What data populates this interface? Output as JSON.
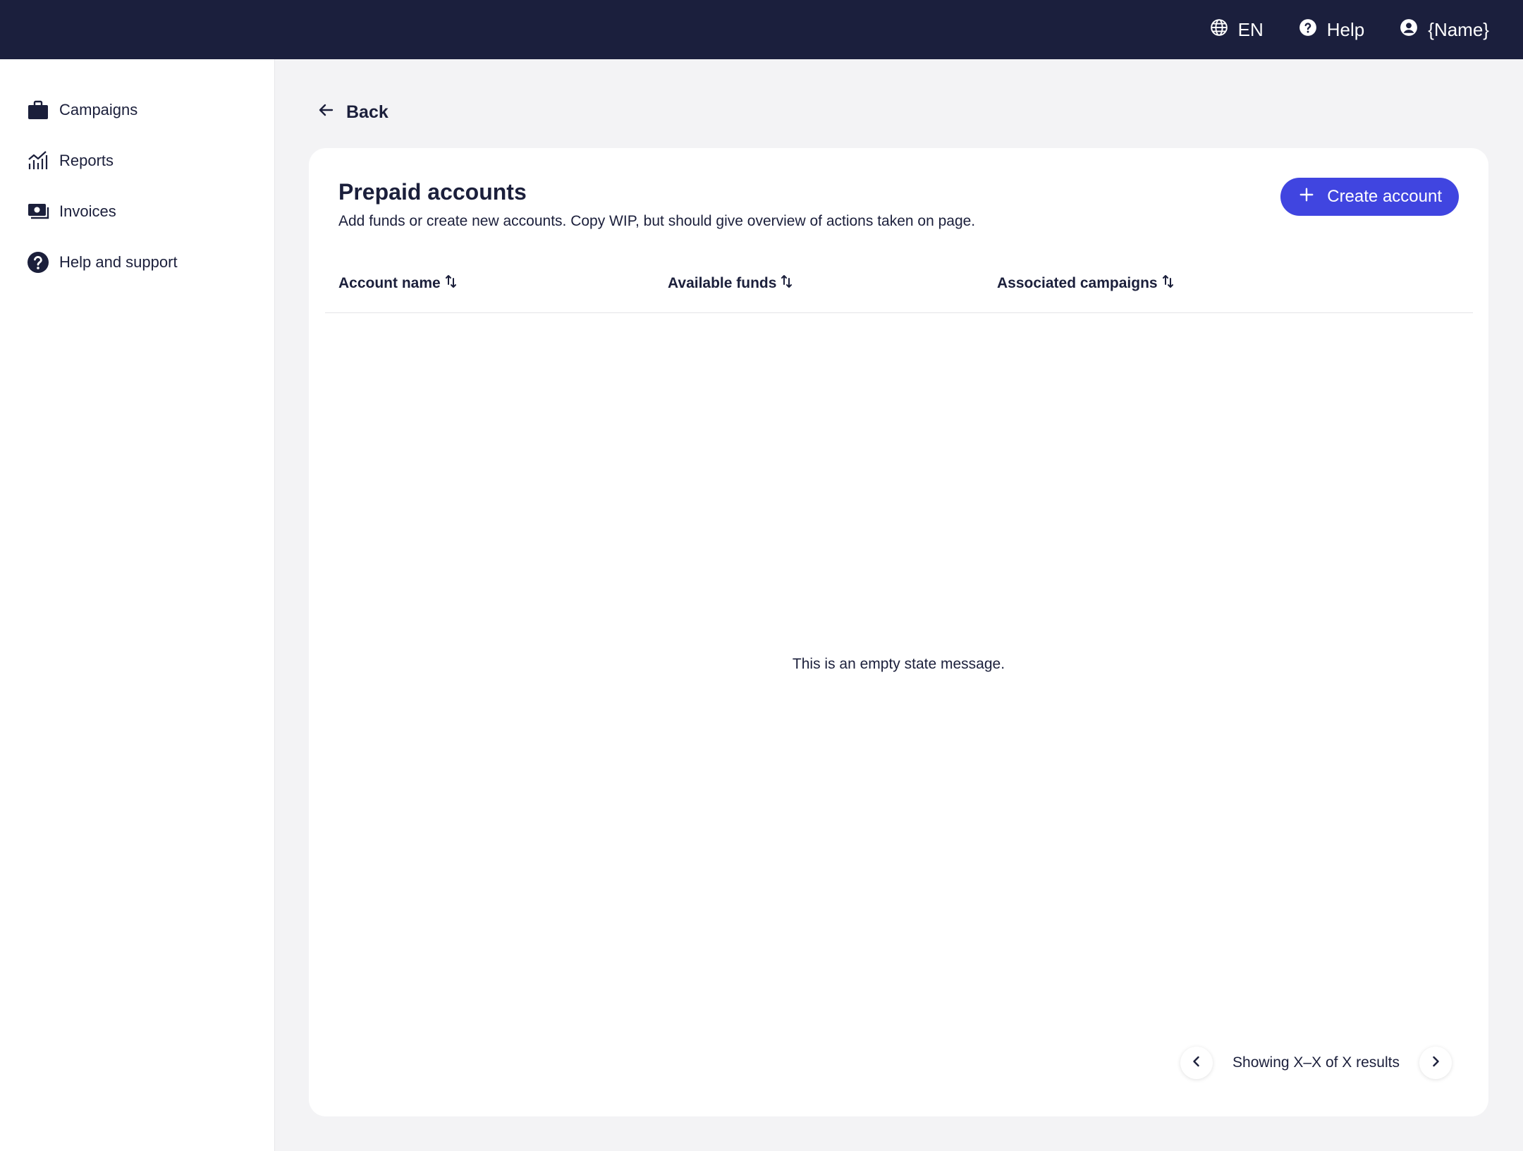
{
  "topbar": {
    "language": {
      "label": "EN",
      "icon": "globe-icon"
    },
    "help": {
      "label": "Help",
      "icon": "question-circle-icon"
    },
    "user": {
      "label": "{Name}",
      "icon": "user-circle-icon"
    }
  },
  "sidebar": {
    "items": [
      {
        "label": "Campaigns",
        "icon": "briefcase-icon"
      },
      {
        "label": "Reports",
        "icon": "chart-icon"
      },
      {
        "label": "Invoices",
        "icon": "money-icon"
      },
      {
        "label": "Help and support",
        "icon": "question-circle-icon"
      }
    ]
  },
  "main": {
    "back_label": "Back",
    "card": {
      "title": "Prepaid accounts",
      "subtitle": "Add funds or create new accounts. Copy WIP, but should give overview of actions taken on page.",
      "create_button": "Create account",
      "columns": [
        "Account name",
        "Available funds",
        "Associated campaigns"
      ],
      "empty_message": "This is an empty state message.",
      "pagination": "Showing X–X of X results"
    }
  },
  "colors": {
    "topbar_bg": "#1b1f3d",
    "accent": "#4045e0",
    "page_bg": "#f3f3f5",
    "text": "#1b1f3b"
  }
}
